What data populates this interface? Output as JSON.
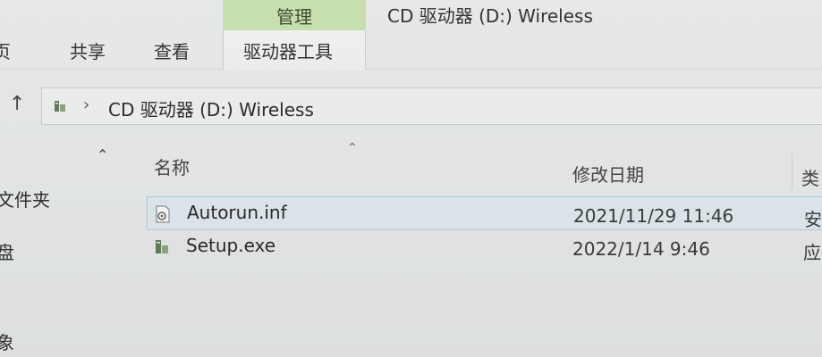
{
  "window": {
    "context_tab": "管理",
    "title": "CD 驱动器 (D:) Wireless"
  },
  "ribbon": {
    "tabs": [
      {
        "label": "页"
      },
      {
        "label": "共享"
      },
      {
        "label": "查看"
      },
      {
        "label": "驱动器工具"
      }
    ]
  },
  "address": {
    "up_glyph": "↑",
    "separator": "›",
    "path": "CD 驱动器 (D:) Wireless"
  },
  "nav": {
    "collapse_glyph": "⌃",
    "items": [
      {
        "label": "文件夹"
      },
      {
        "label": "盘"
      },
      {
        "label": "象"
      }
    ]
  },
  "list": {
    "sort_glyph": "⌃",
    "headers": {
      "name": "名称",
      "modified": "修改日期",
      "type": "类"
    },
    "rows": [
      {
        "name": "Autorun.inf",
        "modified": "2021/11/29 11:46",
        "type": "安",
        "icon": "settings-file-icon",
        "selected": true
      },
      {
        "name": "Setup.exe",
        "modified": "2022/1/14 9:46",
        "type": "应",
        "icon": "installer-file-icon",
        "selected": false
      }
    ]
  },
  "colors": {
    "context_tab_bg": "#c7dfae",
    "selection_border": "#a9c9e4",
    "window_bg": "#e4e7e6"
  }
}
